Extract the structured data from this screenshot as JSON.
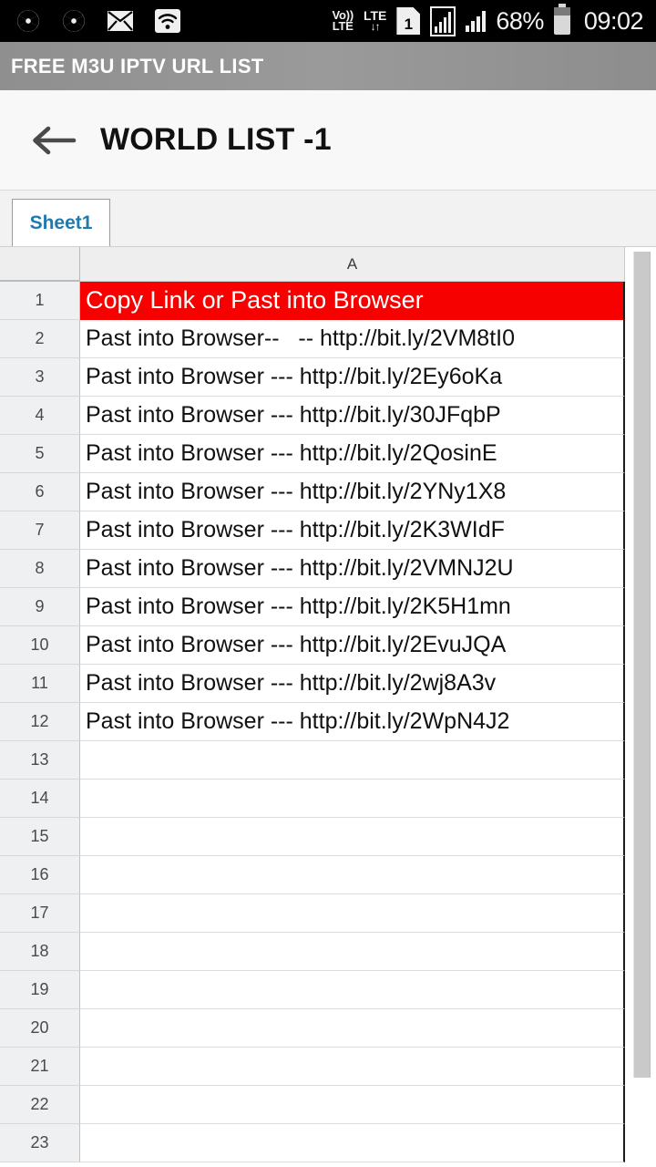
{
  "status_bar": {
    "left_icons": [
      {
        "name": "camera-icon",
        "glyph": "aperture"
      },
      {
        "name": "camera-icon-2",
        "glyph": "aperture"
      },
      {
        "name": "mail-icon",
        "glyph": "envelope"
      },
      {
        "name": "wifi-icon",
        "glyph": "wifi"
      }
    ],
    "volte_top": "Vo))",
    "volte_bottom": "LTE",
    "lte_label": "LTE",
    "lte_arrows": "↓↑",
    "sim_number": "1",
    "battery_percent": "68%",
    "clock": "09:02",
    "background_color": "#000000"
  },
  "app_bar": {
    "title": "FREE M3U IPTV URL LIST",
    "background_color": "#919191",
    "text_color": "#ffffff"
  },
  "doc_header": {
    "back_icon": "arrow-left-icon",
    "title": "WORLD LIST -1"
  },
  "tab_bar": {
    "tabs": [
      {
        "label": "Sheet1",
        "active": true
      }
    ],
    "active_text_color": "#1f7ab0"
  },
  "spreadsheet": {
    "corner_label": "",
    "columns": [
      "A"
    ],
    "banner_color": "#f60000",
    "banner_text_color": "#ffffff",
    "rows": [
      {
        "num": "1",
        "a": "Copy Link or Past into Browser",
        "banner": true
      },
      {
        "num": "2",
        "a": "Past into Browser--   -- http://bit.ly/2VM8tI0",
        "banner": false
      },
      {
        "num": "3",
        "a": "Past into Browser --- http://bit.ly/2Ey6oKa",
        "banner": false
      },
      {
        "num": "4",
        "a": "Past into Browser --- http://bit.ly/30JFqbP",
        "banner": false
      },
      {
        "num": "5",
        "a": "Past into Browser --- http://bit.ly/2QosinE",
        "banner": false
      },
      {
        "num": "6",
        "a": "Past into Browser --- http://bit.ly/2YNy1X8",
        "banner": false
      },
      {
        "num": "7",
        "a": "Past into Browser --- http://bit.ly/2K3WIdF",
        "banner": false
      },
      {
        "num": "8",
        "a": "Past into Browser --- http://bit.ly/2VMNJ2U",
        "banner": false
      },
      {
        "num": "9",
        "a": "Past into Browser --- http://bit.ly/2K5H1mn",
        "banner": false
      },
      {
        "num": "10",
        "a": "Past into Browser --- http://bit.ly/2EvuJQA",
        "banner": false
      },
      {
        "num": "11",
        "a": "Past into Browser --- http://bit.ly/2wj8A3v",
        "banner": false
      },
      {
        "num": "12",
        "a": "Past into Browser --- http://bit.ly/2WpN4J2",
        "banner": false
      },
      {
        "num": "13",
        "a": "",
        "banner": false
      },
      {
        "num": "14",
        "a": "",
        "banner": false
      },
      {
        "num": "15",
        "a": "",
        "banner": false
      },
      {
        "num": "16",
        "a": "",
        "banner": false
      },
      {
        "num": "17",
        "a": "",
        "banner": false
      },
      {
        "num": "18",
        "a": "",
        "banner": false
      },
      {
        "num": "19",
        "a": "",
        "banner": false
      },
      {
        "num": "20",
        "a": "",
        "banner": false
      },
      {
        "num": "21",
        "a": "",
        "banner": false
      },
      {
        "num": "22",
        "a": "",
        "banner": false
      },
      {
        "num": "23",
        "a": "",
        "banner": false
      }
    ]
  }
}
